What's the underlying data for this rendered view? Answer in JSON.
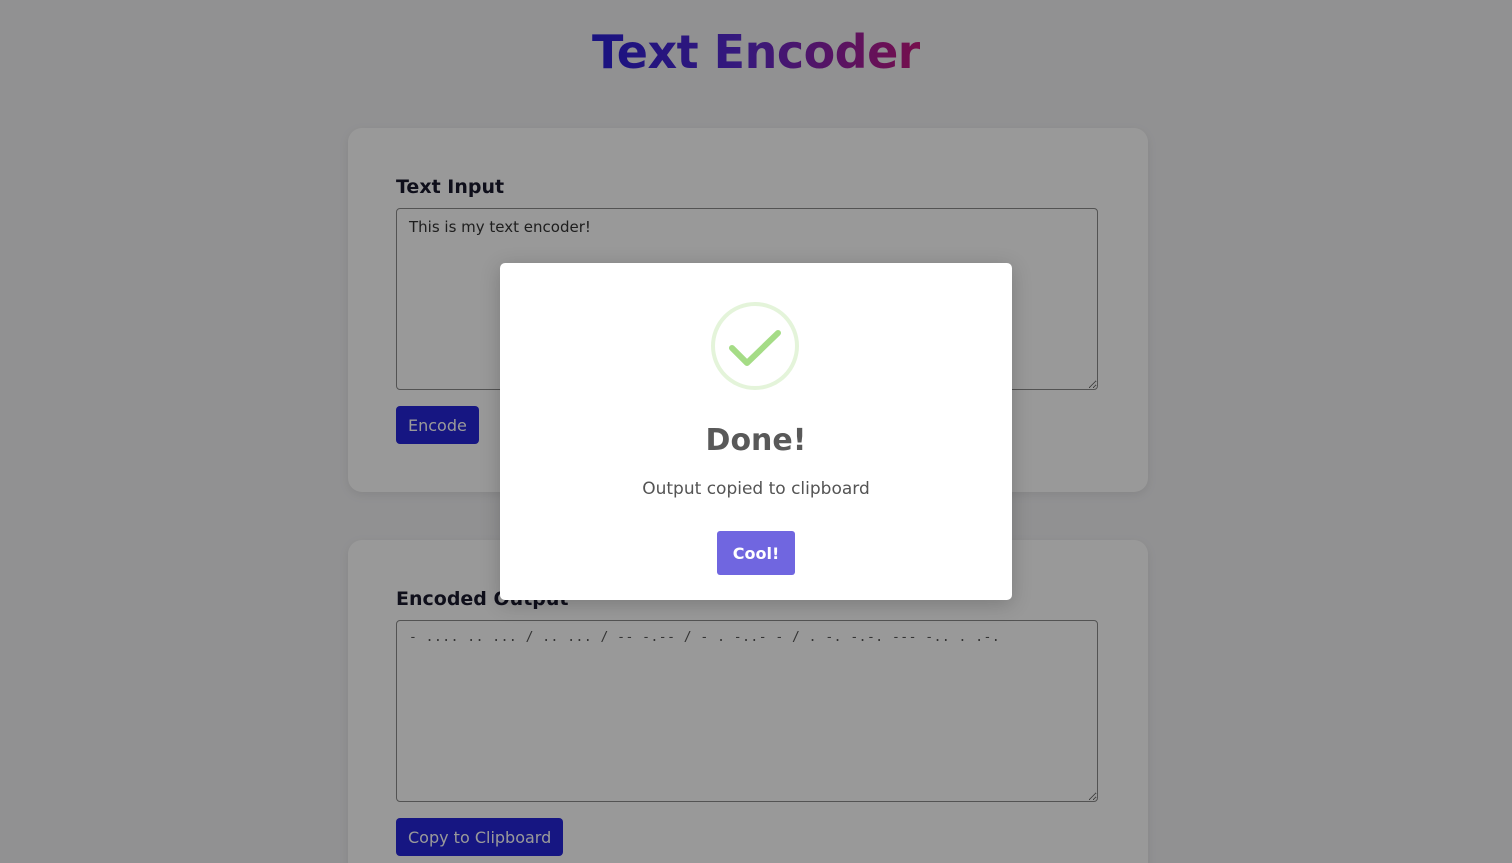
{
  "header": {
    "title": "Text Encoder"
  },
  "input_section": {
    "label": "Text Input",
    "value": "This is my text encoder!",
    "button_label": "Encode"
  },
  "output_section": {
    "label": "Encoded Output",
    "value": "- .... .. ... / .. ... / -- -.-- / - . -..- - / . -. -.-. --- -.. . .-.",
    "button_label": "Copy to Clipboard"
  },
  "modal": {
    "icon": "check-icon",
    "title": "Done!",
    "message": "Output copied to clipboard",
    "confirm_label": "Cool!"
  },
  "colors": {
    "primary_button": "#2626d9",
    "modal_confirm": "#7066e0",
    "success_icon": "#a5dc86",
    "title_gradient_start": "#2a1fd6",
    "title_gradient_end": "#c4197f"
  }
}
